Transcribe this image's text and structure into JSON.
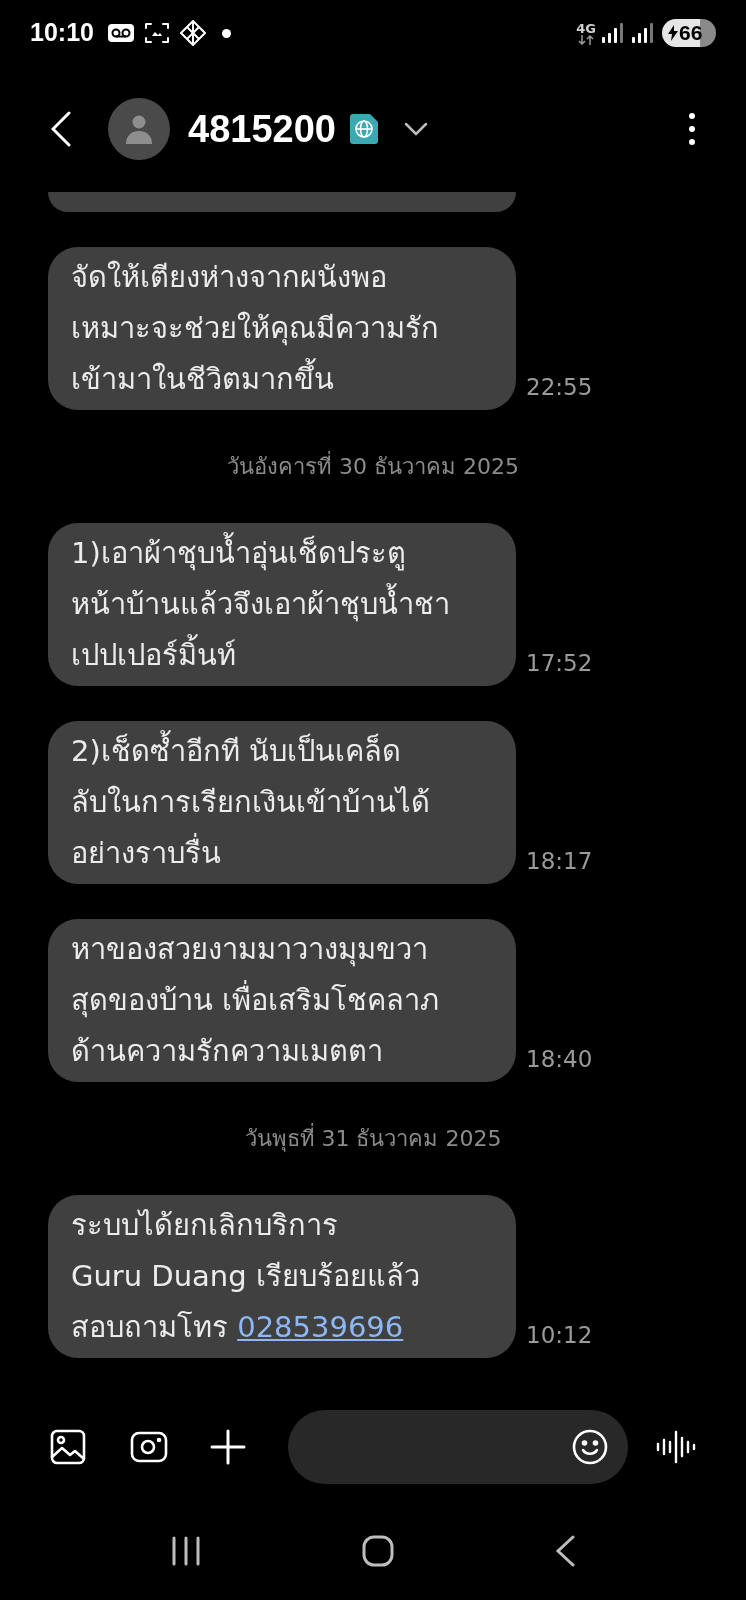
{
  "status_bar": {
    "time": "10:10",
    "network": "4G",
    "battery": "66"
  },
  "header": {
    "title": "4815200"
  },
  "conversation": [
    {
      "kind": "cut"
    },
    {
      "kind": "message",
      "lines": [
        "จัดให้เตียงห่างจากผนังพอ",
        "เหมาะจะช่วยให้คุณมีความรัก",
        "เข้ามาในชีวิตมากขึ้น"
      ],
      "time": "22:55"
    },
    {
      "kind": "date",
      "text": "วันอังคารที่ 30 ธันวาคม 2025"
    },
    {
      "kind": "message",
      "lines": [
        "1)เอาผ้าชุบน้ำอุ่นเช็ดประตู",
        "หน้าบ้านแล้วจึงเอาผ้าชุบน้ำชา",
        "เปปเปอร์มิ้นท์"
      ],
      "time": "17:52"
    },
    {
      "kind": "message",
      "lines": [
        "2)เช็ดซ้ำอีกที นับเป็นเคล็ด",
        "ลับในการเรียกเงินเข้าบ้านได้",
        "อย่างราบรื่น"
      ],
      "time": "18:17"
    },
    {
      "kind": "message",
      "lines": [
        "หาของสวยงามมาวางมุมขวา",
        "สุดของบ้าน เพื่อเสริมโชคลาภ",
        "ด้านความรักความเมตตา"
      ],
      "time": "18:40"
    },
    {
      "kind": "date",
      "text": "วันพุธที่ 31 ธันวาคม 2025"
    },
    {
      "kind": "message",
      "lines": [
        "ระบบได้ยกเลิกบริการ",
        "Guru Duang เรียบร้อยแล้ว",
        "สอบถามโทร "
      ],
      "link": "028539696",
      "time": "10:12"
    }
  ]
}
